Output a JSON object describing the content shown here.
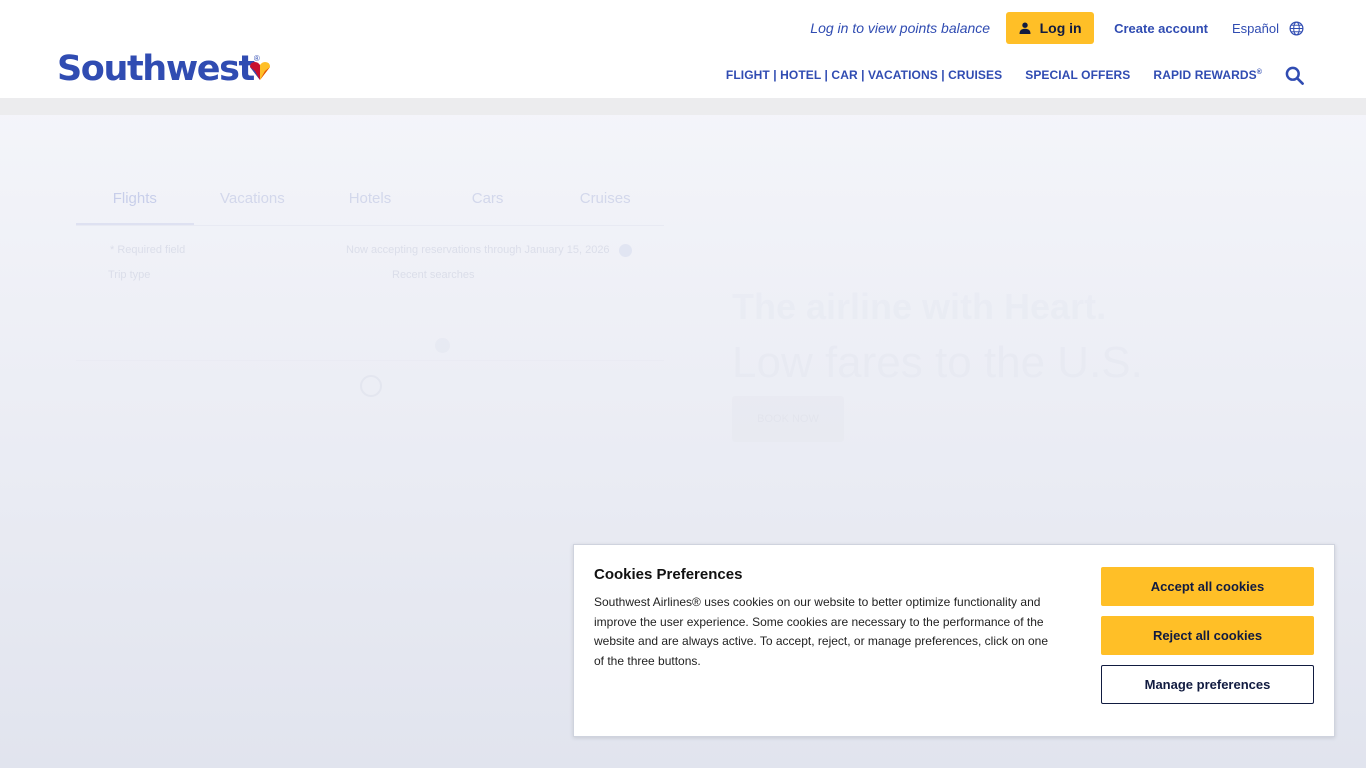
{
  "header": {
    "logo_text": "Southwest",
    "logo_reg": "®",
    "points_link": "Log in to view points balance",
    "login_label": "Log in",
    "create_account": "Create account",
    "language": "Español",
    "nav": {
      "booking": "FLIGHT | HOTEL | CAR | VACATIONS | CRUISES",
      "special_offers": "SPECIAL OFFERS",
      "rapid_rewards": "RAPID REWARDS",
      "rapid_rewards_reg": "®"
    }
  },
  "hero": {
    "tabs": [
      "Flights",
      "Vacations",
      "Hotels",
      "Cars",
      "Cruises"
    ],
    "required_note": "* Required field",
    "booking_note": "Now accepting reservations through January 15, 2026",
    "trip_type_label": "Trip type",
    "recent_searches": "Recent searches",
    "title": "The airline with Heart.",
    "subtitle": "Low fares to the U.S.",
    "cta": "BOOK NOW"
  },
  "cookies": {
    "title": "Cookies Preferences",
    "text": "Southwest Airlines® uses cookies on our website to better optimize functionality and improve the user experience. Some cookies are necessary to the performance of the website and are always active. To accept, reject, or manage preferences, click on one of the three buttons.",
    "accept": "Accept all cookies",
    "reject": "Reject all cookies",
    "manage": "Manage preferences"
  },
  "colors": {
    "brand_blue": "#304cb2",
    "brand_yellow": "#ffbf27",
    "navy": "#111b40"
  },
  "icons": {
    "heart": "southwest-heart-icon",
    "user": "user-icon",
    "globe": "globe-icon",
    "search": "search-icon"
  }
}
